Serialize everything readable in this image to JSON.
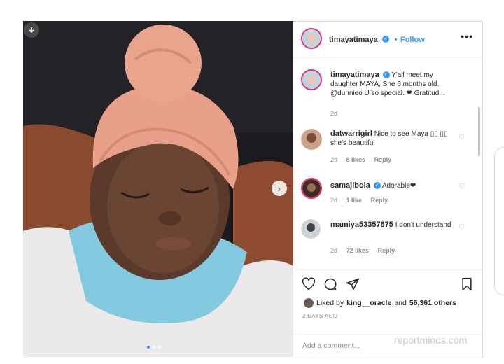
{
  "post": {
    "author": "timayatimaya",
    "follow_label": "Follow",
    "more_label": "•••",
    "next_label": "›"
  },
  "comments": [
    {
      "user": "timayatimaya",
      "verified": true,
      "text": "Y'all meet my daughter MAYA, She 6 months old. @dunnieo U so special. ❤ Gratitud...",
      "time": "2d"
    },
    {
      "user": "datwarrigirl",
      "verified": false,
      "text": "Nice to see Maya ▯▯ ▯▯ she's beautiful",
      "time": "2d",
      "likes": "8 likes",
      "reply": "Reply"
    },
    {
      "user": "samajibola",
      "verified": true,
      "text": "Adorable❤",
      "time": "2d",
      "likes": "1 like",
      "reply": "Reply"
    },
    {
      "user": "mamiya53357675",
      "verified": false,
      "text": "I don't understand",
      "time": "2d",
      "likes": "72 likes",
      "reply": "Reply"
    }
  ],
  "actions": {
    "liked_prefix": "Liked by",
    "liked_user": "king__oracle",
    "liked_and": "and",
    "liked_count": "56,361 others",
    "time_ago": "2 DAYS AGO",
    "add_comment_placeholder": "Add a comment..."
  },
  "watermark": "reportminds.com",
  "icons": [
    "download-icon",
    "next-arrow-icon",
    "more-options-icon",
    "heart-icon",
    "comment-icon",
    "share-icon",
    "bookmark-icon",
    "verified-badge-icon"
  ]
}
